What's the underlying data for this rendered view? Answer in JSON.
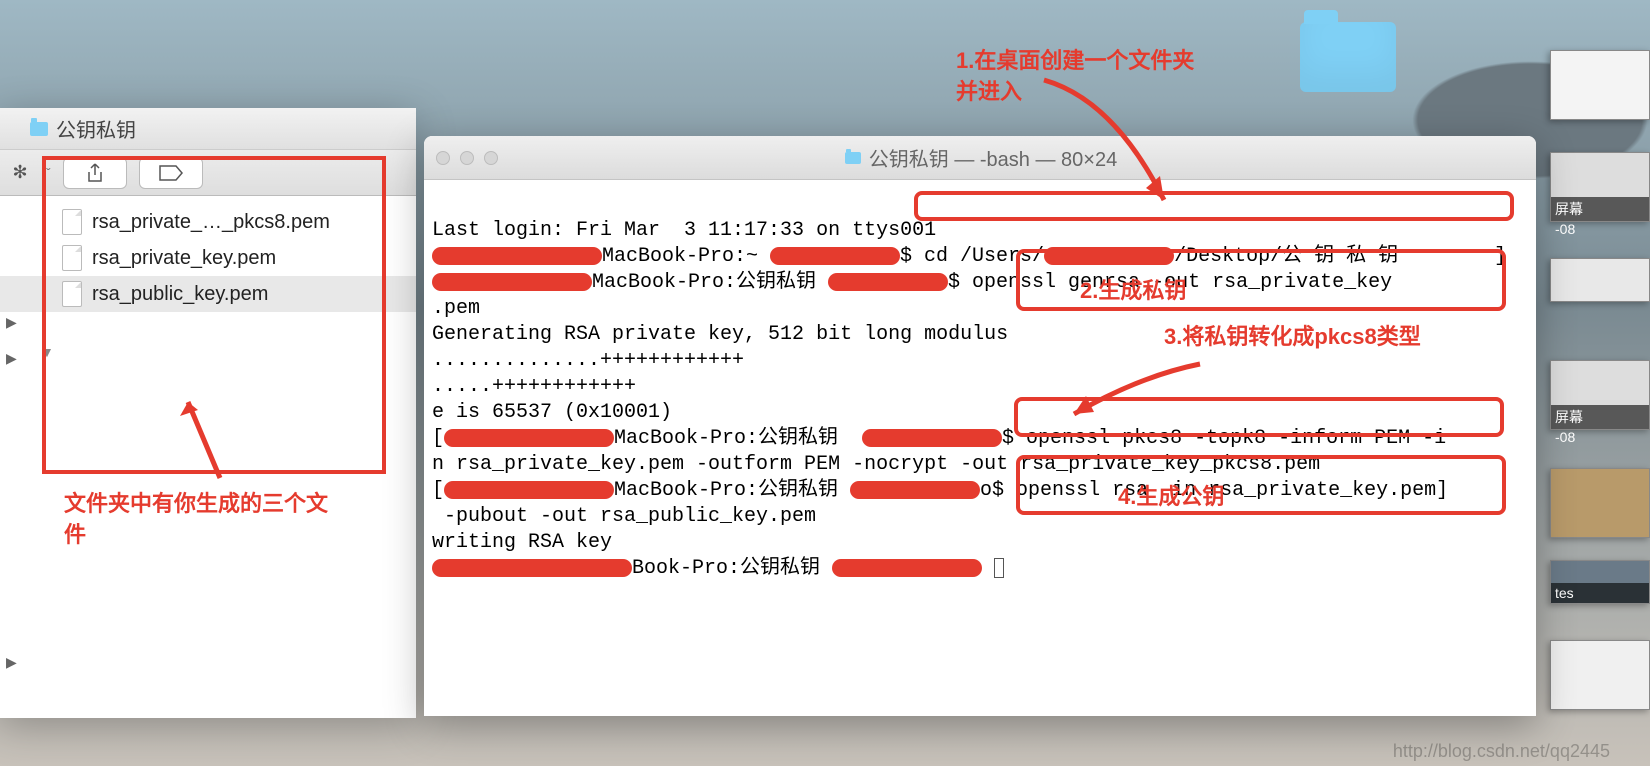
{
  "annotations": {
    "folder_note": "文件夹中有你生成的三个文件",
    "step1": "1.在桌面创建一个文件夹   并进入",
    "step2": "2.生成私钥",
    "step3": "3.将私钥转化成pkcs8类型",
    "step4": "4.生成公钥"
  },
  "finder": {
    "title": "公钥私钥",
    "files": [
      "rsa_private_…_pkcs8.pem",
      "rsa_private_key.pem",
      "rsa_public_key.pem"
    ]
  },
  "terminal": {
    "title": "公钥私钥 — -bash — 80×24",
    "lines": {
      "l1a": "Last login: Fri Mar  3 11:17:33 on ttys001",
      "l2a": "MacBook-Pro:~ ",
      "l2b": "$ cd /Users/",
      "l2c": "/Desktop/公 钥 私 钥        ]",
      "l3a": "MacBook-Pro:公钥私钥 ",
      "l3b": "$ openssl genrsa -out rsa_private_key",
      "l4": ".pem",
      "l5": "Generating RSA private key, 512 bit long modulus",
      "l6": "..............++++++++++++",
      "l7": ".....++++++++++++",
      "l8": "e is 65537 (0x10001)",
      "l9a": "[",
      "l9b": "MacBook-Pro:公钥私钥  ",
      "l9c": "$ openssl pkcs8 -topk8 -inform PEM -i",
      "l10": "n rsa_private_key.pem -outform PEM -nocrypt -out rsa_private_key_pkcs8.pem",
      "l11a": "[",
      "l11b": "MacBook-Pro:公钥私钥 ",
      "l11c": "o$ openssl rsa  in rsa_private_key.pem]",
      "l12": " -pubout -out rsa_public_key.pem",
      "l13": "writing RSA key",
      "l14a": "Book-Pro:公钥私钥 "
    }
  },
  "watermark": "http://blog.csdn.net/qq2445"
}
